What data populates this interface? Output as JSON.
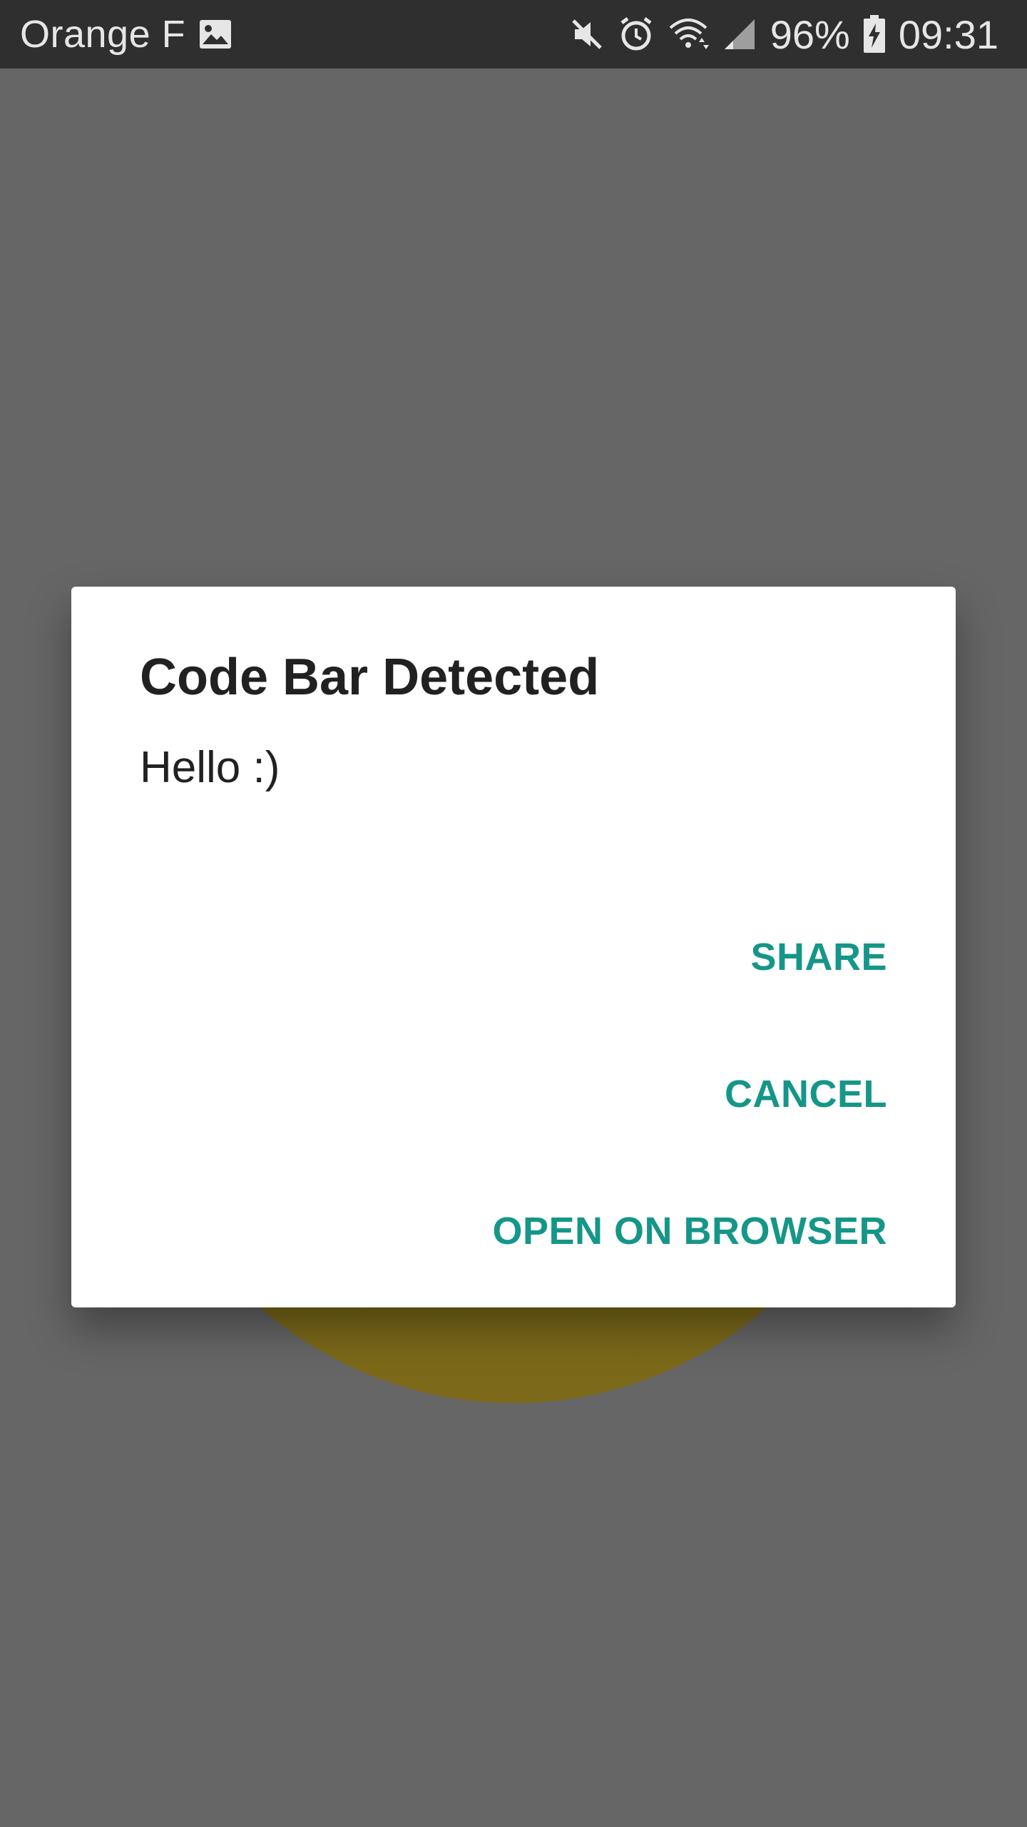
{
  "status_bar": {
    "carrier": "Orange F",
    "battery_percent": "96%",
    "time": "09:31",
    "icons": [
      "image-icon",
      "mute-icon",
      "alarm-icon",
      "wifi-icon",
      "signal-icon",
      "battery-charging-icon"
    ]
  },
  "dialog": {
    "title": "Code Bar Detected",
    "message": "Hello :)",
    "buttons": {
      "share": "SHARE",
      "cancel": "CANCEL",
      "open_browser": "OPEN ON BROWSER"
    }
  },
  "colors": {
    "accent": "#159688",
    "scrim": "#666666",
    "status_bar": "#2f2f2f"
  }
}
